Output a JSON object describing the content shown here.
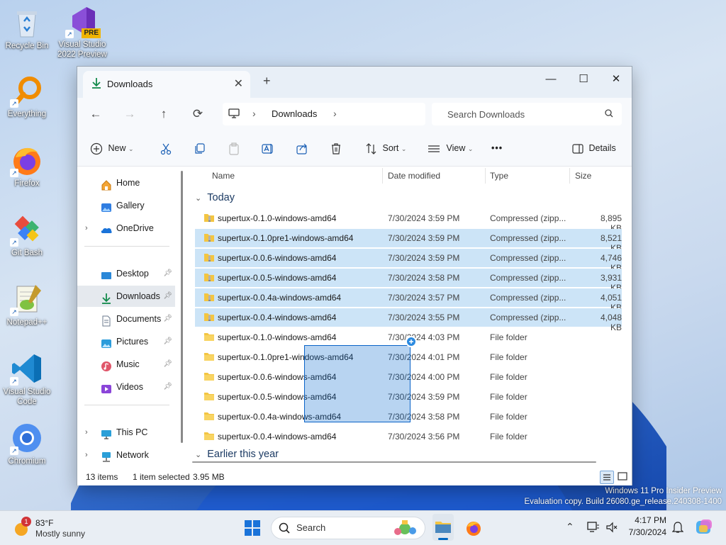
{
  "desktop": {
    "icons": [
      {
        "label": "Recycle Bin"
      },
      {
        "label": "Visual Studio 2022 Preview",
        "badge": "PRE"
      },
      {
        "label": "Everything"
      },
      {
        "label": "Firefox"
      },
      {
        "label": "Git Bash"
      },
      {
        "label": "Notepad++"
      },
      {
        "label": "Visual Studio Code"
      },
      {
        "label": "Chromium"
      }
    ],
    "watermark_line1": "Windows 11 Pro Insider Preview",
    "watermark_line2": "Evaluation copy. Build 26080.ge_release.240308-1400"
  },
  "explorer": {
    "tab_title": "Downloads",
    "tab_close": "✕",
    "new_tab": "+",
    "window_controls": {
      "minimize": "—",
      "maximize": "☐",
      "close": "✕"
    },
    "breadcrumb": {
      "location": "Downloads",
      "sep1": "›",
      "sep2": "›"
    },
    "search_placeholder": "Search Downloads",
    "toolbar": {
      "new_label": "New",
      "sort_label": "Sort",
      "view_label": "View",
      "more_label": "•••",
      "details_label": "Details"
    },
    "nav": {
      "home": "Home",
      "gallery": "Gallery",
      "onedrive": "OneDrive",
      "desktop": "Desktop",
      "downloads": "Downloads",
      "documents": "Documents",
      "pictures": "Pictures",
      "music": "Music",
      "videos": "Videos",
      "this_pc": "This PC",
      "network": "Network"
    },
    "columns": {
      "name": "Name",
      "date": "Date modified",
      "type": "Type",
      "size": "Size"
    },
    "groups": {
      "today": "Today",
      "earlier": "Earlier this year"
    },
    "files": [
      {
        "name": "supertux-0.1.0-windows-amd64",
        "date": "7/30/2024 3:59 PM",
        "type": "Compressed (zipp...",
        "size": "8,895 KB",
        "kind": "zip",
        "selected": false
      },
      {
        "name": "supertux-0.1.0pre1-windows-amd64",
        "date": "7/30/2024 3:59 PM",
        "type": "Compressed (zipp...",
        "size": "8,521 KB",
        "kind": "zip",
        "selected": true
      },
      {
        "name": "supertux-0.0.6-windows-amd64",
        "date": "7/30/2024 3:59 PM",
        "type": "Compressed (zipp...",
        "size": "4,746 KB",
        "kind": "zip",
        "selected": true
      },
      {
        "name": "supertux-0.0.5-windows-amd64",
        "date": "7/30/2024 3:58 PM",
        "type": "Compressed (zipp...",
        "size": "3,931 KB",
        "kind": "zip",
        "selected": true
      },
      {
        "name": "supertux-0.0.4a-windows-amd64",
        "date": "7/30/2024 3:57 PM",
        "type": "Compressed (zipp...",
        "size": "4,051 KB",
        "kind": "zip",
        "selected": true
      },
      {
        "name": "supertux-0.0.4-windows-amd64",
        "date": "7/30/2024 3:55 PM",
        "type": "Compressed (zipp...",
        "size": "4,048 KB",
        "kind": "zip",
        "selected": true
      },
      {
        "name": "supertux-0.1.0-windows-amd64",
        "date": "7/30/2024 4:03 PM",
        "type": "File folder",
        "size": "",
        "kind": "folder",
        "selected": false
      },
      {
        "name": "supertux-0.1.0pre1-windows-amd64",
        "date": "7/30/2024 4:01 PM",
        "type": "File folder",
        "size": "",
        "kind": "folder",
        "selected": false
      },
      {
        "name": "supertux-0.0.6-windows-amd64",
        "date": "7/30/2024 4:00 PM",
        "type": "File folder",
        "size": "",
        "kind": "folder",
        "selected": false
      },
      {
        "name": "supertux-0.0.5-windows-amd64",
        "date": "7/30/2024 3:59 PM",
        "type": "File folder",
        "size": "",
        "kind": "folder",
        "selected": false
      },
      {
        "name": "supertux-0.0.4a-windows-amd64",
        "date": "7/30/2024 3:58 PM",
        "type": "File folder",
        "size": "",
        "kind": "folder",
        "selected": false
      },
      {
        "name": "supertux-0.0.4-windows-amd64",
        "date": "7/30/2024 3:56 PM",
        "type": "File folder",
        "size": "",
        "kind": "folder",
        "selected": false
      }
    ],
    "status": {
      "items": "13 items",
      "selected": "1 item selected",
      "size": "3.95 MB"
    }
  },
  "taskbar": {
    "weather_temp": "83°F",
    "weather_desc": "Mostly sunny",
    "weather_badge": "1",
    "search_label": "Search",
    "time": "4:17 PM",
    "date": "7/30/2024",
    "chevron": "⌃"
  },
  "colors": {
    "accent": "#0067c0",
    "selection": "#cce4f7",
    "folder": "#f3c542"
  }
}
